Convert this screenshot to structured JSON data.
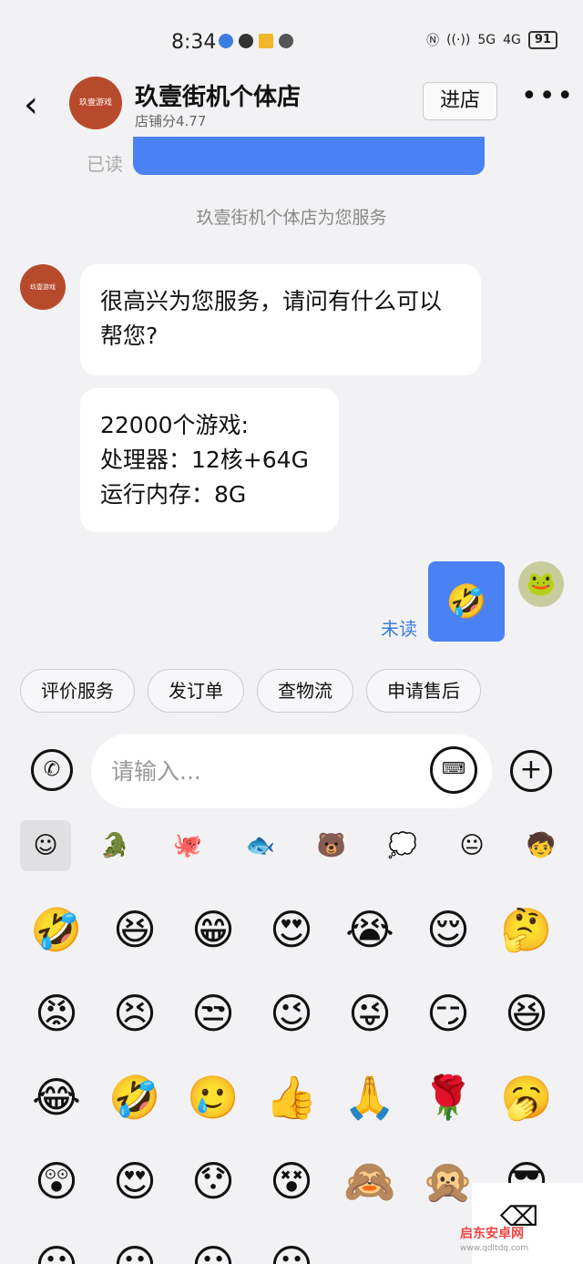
{
  "status_bar": {
    "time": "8:34",
    "battery": "91",
    "net1": "5G",
    "net2": "4G"
  },
  "header": {
    "back_glyph": "‹",
    "avatar_text": "玖壹游戏",
    "title": "玖壹街机个体店",
    "score": "店铺分4.77",
    "enter_label": "进店",
    "more_glyph": "•••"
  },
  "chat": {
    "read_label": "已读",
    "service_notice": "玖壹街机个体店为您服务",
    "bot_avatar_text": "玖壹游戏",
    "msg1": "很高兴为您服务，请问有什么可以帮您?",
    "msg2_lines": [
      "22000个游戏:",
      "处理器：12核+64G",
      "运行内存：8G"
    ],
    "unread_label": "未读",
    "sent_emoji": "🤣",
    "my_avatar": "🐸"
  },
  "quick_actions": [
    "评价服务",
    "发订单",
    "查物流",
    "申请售后"
  ],
  "input": {
    "placeholder": "请输入...",
    "phone_glyph": "✆",
    "keyboard_glyph": "⌨",
    "plus_glyph": "+"
  },
  "emoji_tabs": [
    "☺",
    "🐊",
    "🐙",
    "🐟",
    "🐻",
    "💭",
    "😐",
    "🧒"
  ],
  "emoji_grid": [
    "🤣",
    "😆",
    "😁",
    "😍",
    "😭",
    "😌",
    "🤔",
    "😡",
    "😣",
    "😒",
    "😉",
    "😜",
    "😏",
    "😆",
    "😂",
    "🤣",
    "🥲",
    "👍",
    "🙏",
    "🌹",
    "🥱",
    "😲",
    "😍",
    "😯",
    "😵",
    "🙈",
    "🙊",
    "😎",
    "😀",
    "😀",
    "😀",
    "😀"
  ],
  "delete_glyph": "⌫",
  "watermark": {
    "title": "启东安卓网",
    "url": "www.qdltdq.com"
  }
}
